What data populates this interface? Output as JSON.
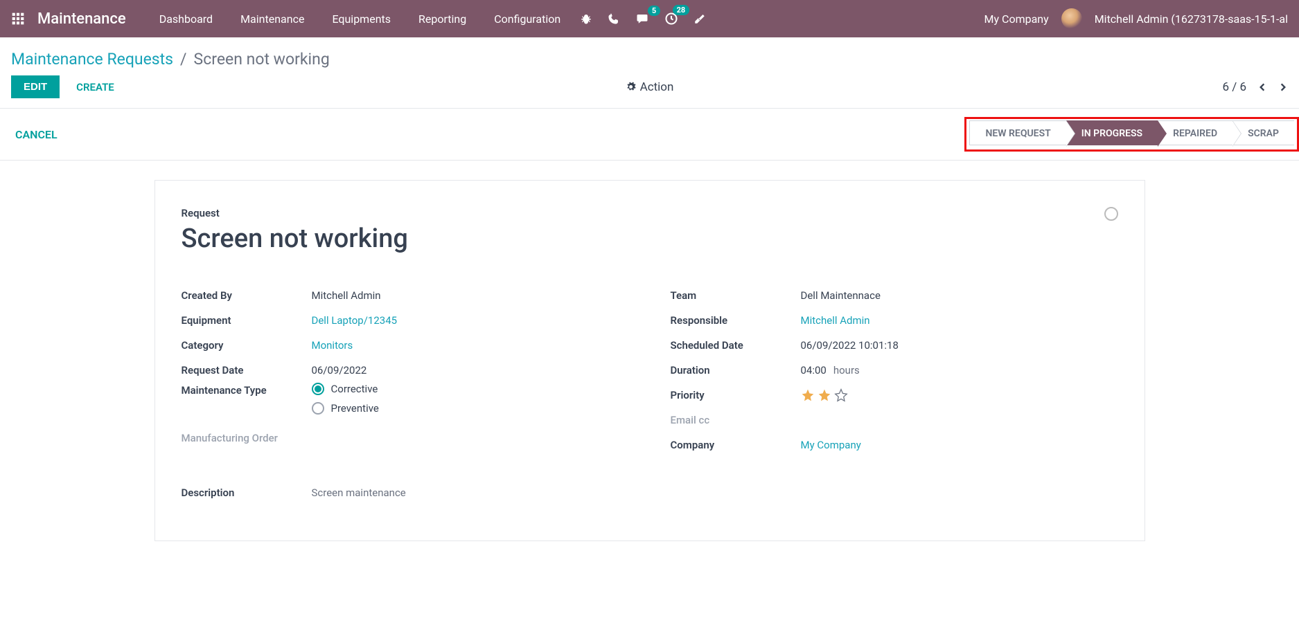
{
  "navbar": {
    "brand": "Maintenance",
    "menu": [
      "Dashboard",
      "Maintenance",
      "Equipments",
      "Reporting",
      "Configuration"
    ],
    "badges": {
      "messages": "5",
      "activities": "28"
    },
    "company": "My Company",
    "user": "Mitchell Admin (16273178-saas-15-1-al"
  },
  "breadcrumb": {
    "parent": "Maintenance Requests",
    "current": "Screen not working"
  },
  "buttons": {
    "edit": "EDIT",
    "create": "CREATE",
    "action": "Action",
    "cancel": "CANCEL"
  },
  "pager": {
    "text": "6 / 6"
  },
  "status_steps": [
    "NEW REQUEST",
    "IN PROGRESS",
    "REPAIRED",
    "SCRAP"
  ],
  "status_active_index": 1,
  "form": {
    "request_label": "Request",
    "title": "Screen not working",
    "labels": {
      "created_by": "Created By",
      "equipment": "Equipment",
      "category": "Category",
      "request_date": "Request Date",
      "maintenance_type": "Maintenance Type",
      "manufacturing_order": "Manufacturing Order",
      "team": "Team",
      "responsible": "Responsible",
      "scheduled_date": "Scheduled Date",
      "duration": "Duration",
      "priority": "Priority",
      "email_cc": "Email cc",
      "company": "Company",
      "description": "Description"
    },
    "values": {
      "created_by": "Mitchell Admin",
      "equipment": "Dell Laptop/12345",
      "category": "Monitors",
      "request_date": "06/09/2022",
      "maintenance_type_options": {
        "corrective": "Corrective",
        "preventive": "Preventive"
      },
      "maintenance_type_selected": "corrective",
      "team": "Dell Maintennace",
      "responsible": "Mitchell Admin",
      "scheduled_date": "06/09/2022 10:01:18",
      "duration": "04:00",
      "duration_unit": "hours",
      "priority_stars": 2,
      "priority_max": 3,
      "company": "My Company",
      "description": "Screen maintenance"
    }
  }
}
